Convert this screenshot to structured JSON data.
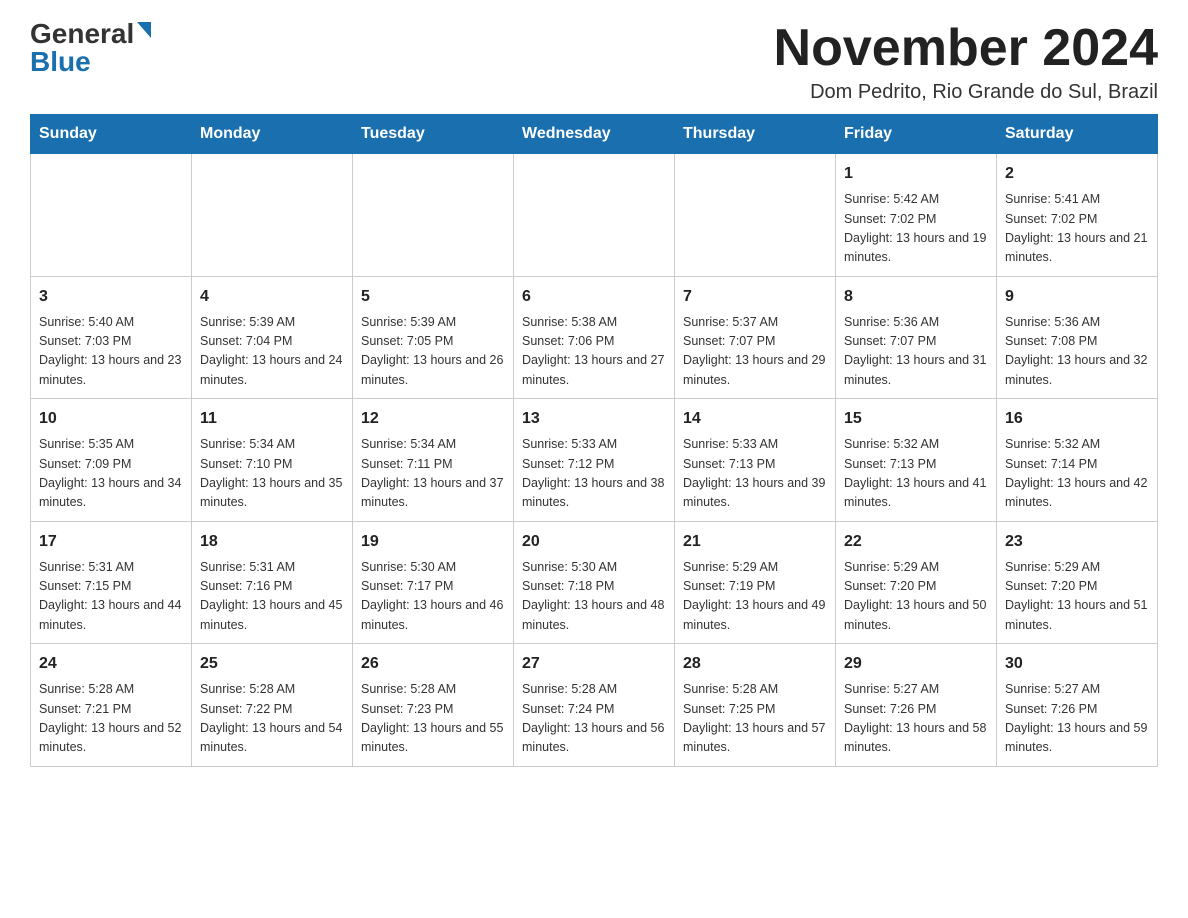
{
  "logo": {
    "general": "General",
    "triangle": "▶",
    "blue": "Blue"
  },
  "header": {
    "title": "November 2024",
    "subtitle": "Dom Pedrito, Rio Grande do Sul, Brazil"
  },
  "weekdays": [
    "Sunday",
    "Monday",
    "Tuesday",
    "Wednesday",
    "Thursday",
    "Friday",
    "Saturday"
  ],
  "weeks": [
    [
      {
        "day": "",
        "info": ""
      },
      {
        "day": "",
        "info": ""
      },
      {
        "day": "",
        "info": ""
      },
      {
        "day": "",
        "info": ""
      },
      {
        "day": "",
        "info": ""
      },
      {
        "day": "1",
        "info": "Sunrise: 5:42 AM\nSunset: 7:02 PM\nDaylight: 13 hours and 19 minutes."
      },
      {
        "day": "2",
        "info": "Sunrise: 5:41 AM\nSunset: 7:02 PM\nDaylight: 13 hours and 21 minutes."
      }
    ],
    [
      {
        "day": "3",
        "info": "Sunrise: 5:40 AM\nSunset: 7:03 PM\nDaylight: 13 hours and 23 minutes."
      },
      {
        "day": "4",
        "info": "Sunrise: 5:39 AM\nSunset: 7:04 PM\nDaylight: 13 hours and 24 minutes."
      },
      {
        "day": "5",
        "info": "Sunrise: 5:39 AM\nSunset: 7:05 PM\nDaylight: 13 hours and 26 minutes."
      },
      {
        "day": "6",
        "info": "Sunrise: 5:38 AM\nSunset: 7:06 PM\nDaylight: 13 hours and 27 minutes."
      },
      {
        "day": "7",
        "info": "Sunrise: 5:37 AM\nSunset: 7:07 PM\nDaylight: 13 hours and 29 minutes."
      },
      {
        "day": "8",
        "info": "Sunrise: 5:36 AM\nSunset: 7:07 PM\nDaylight: 13 hours and 31 minutes."
      },
      {
        "day": "9",
        "info": "Sunrise: 5:36 AM\nSunset: 7:08 PM\nDaylight: 13 hours and 32 minutes."
      }
    ],
    [
      {
        "day": "10",
        "info": "Sunrise: 5:35 AM\nSunset: 7:09 PM\nDaylight: 13 hours and 34 minutes."
      },
      {
        "day": "11",
        "info": "Sunrise: 5:34 AM\nSunset: 7:10 PM\nDaylight: 13 hours and 35 minutes."
      },
      {
        "day": "12",
        "info": "Sunrise: 5:34 AM\nSunset: 7:11 PM\nDaylight: 13 hours and 37 minutes."
      },
      {
        "day": "13",
        "info": "Sunrise: 5:33 AM\nSunset: 7:12 PM\nDaylight: 13 hours and 38 minutes."
      },
      {
        "day": "14",
        "info": "Sunrise: 5:33 AM\nSunset: 7:13 PM\nDaylight: 13 hours and 39 minutes."
      },
      {
        "day": "15",
        "info": "Sunrise: 5:32 AM\nSunset: 7:13 PM\nDaylight: 13 hours and 41 minutes."
      },
      {
        "day": "16",
        "info": "Sunrise: 5:32 AM\nSunset: 7:14 PM\nDaylight: 13 hours and 42 minutes."
      }
    ],
    [
      {
        "day": "17",
        "info": "Sunrise: 5:31 AM\nSunset: 7:15 PM\nDaylight: 13 hours and 44 minutes."
      },
      {
        "day": "18",
        "info": "Sunrise: 5:31 AM\nSunset: 7:16 PM\nDaylight: 13 hours and 45 minutes."
      },
      {
        "day": "19",
        "info": "Sunrise: 5:30 AM\nSunset: 7:17 PM\nDaylight: 13 hours and 46 minutes."
      },
      {
        "day": "20",
        "info": "Sunrise: 5:30 AM\nSunset: 7:18 PM\nDaylight: 13 hours and 48 minutes."
      },
      {
        "day": "21",
        "info": "Sunrise: 5:29 AM\nSunset: 7:19 PM\nDaylight: 13 hours and 49 minutes."
      },
      {
        "day": "22",
        "info": "Sunrise: 5:29 AM\nSunset: 7:20 PM\nDaylight: 13 hours and 50 minutes."
      },
      {
        "day": "23",
        "info": "Sunrise: 5:29 AM\nSunset: 7:20 PM\nDaylight: 13 hours and 51 minutes."
      }
    ],
    [
      {
        "day": "24",
        "info": "Sunrise: 5:28 AM\nSunset: 7:21 PM\nDaylight: 13 hours and 52 minutes."
      },
      {
        "day": "25",
        "info": "Sunrise: 5:28 AM\nSunset: 7:22 PM\nDaylight: 13 hours and 54 minutes."
      },
      {
        "day": "26",
        "info": "Sunrise: 5:28 AM\nSunset: 7:23 PM\nDaylight: 13 hours and 55 minutes."
      },
      {
        "day": "27",
        "info": "Sunrise: 5:28 AM\nSunset: 7:24 PM\nDaylight: 13 hours and 56 minutes."
      },
      {
        "day": "28",
        "info": "Sunrise: 5:28 AM\nSunset: 7:25 PM\nDaylight: 13 hours and 57 minutes."
      },
      {
        "day": "29",
        "info": "Sunrise: 5:27 AM\nSunset: 7:26 PM\nDaylight: 13 hours and 58 minutes."
      },
      {
        "day": "30",
        "info": "Sunrise: 5:27 AM\nSunset: 7:26 PM\nDaylight: 13 hours and 59 minutes."
      }
    ]
  ]
}
